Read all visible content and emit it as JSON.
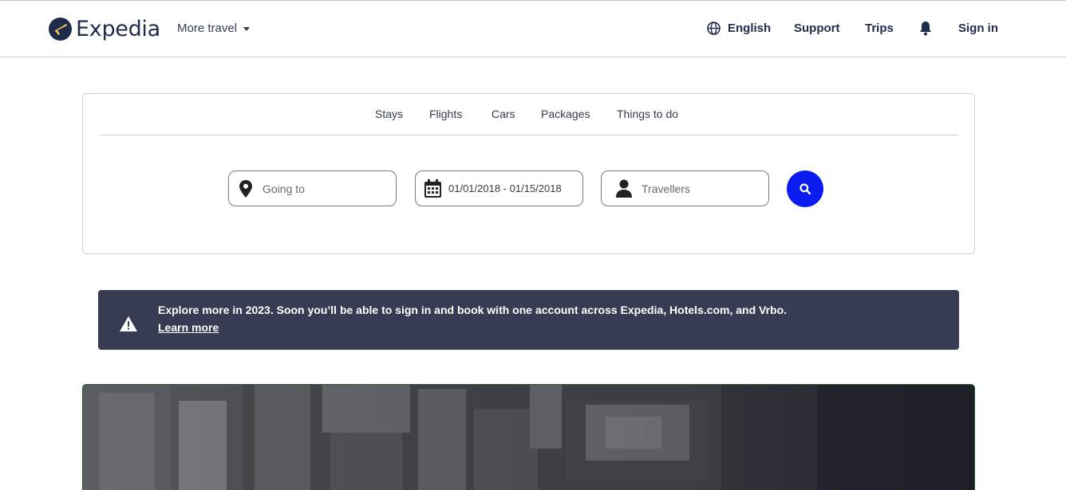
{
  "header": {
    "brand": "Expedia",
    "more_travel": "More travel",
    "language": "English",
    "support": "Support",
    "trips": "Trips",
    "sign_in": "Sign in"
  },
  "tabs": [
    "Stays",
    "Flights",
    "Cars",
    "Packages",
    "Things to do"
  ],
  "search": {
    "destination_placeholder": "Going to",
    "dates_value": "01/01/2018 - 01/15/2018",
    "travellers_placeholder": "Travellers"
  },
  "banner": {
    "message": "Explore more in 2023. Soon you’ll be able to sign in and book with one account across Expedia, Hotels.com, and Vrbo.",
    "link": "Learn more"
  },
  "colors": {
    "brand_navy": "#1f2b4a",
    "search_button": "#0a1cf0",
    "banner_bg": "#373b54"
  },
  "icons": {
    "logo": "plane-logo-icon",
    "language": "globe-icon",
    "notifications": "bell-icon",
    "destination": "map-pin-icon",
    "dates": "calendar-icon",
    "travellers": "person-icon",
    "search": "search-icon",
    "banner": "warning-icon"
  }
}
